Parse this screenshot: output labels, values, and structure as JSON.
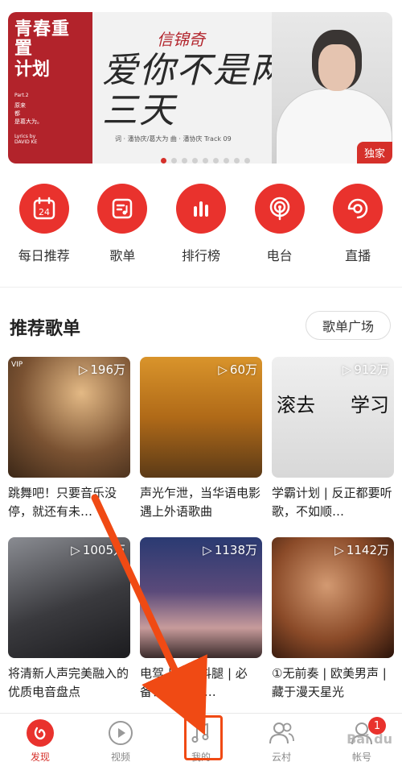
{
  "banner": {
    "left_title_line1": "青春重置",
    "left_title_line2": "计划",
    "part": "Part.2",
    "left_lines": [
      "原来",
      "都",
      "是葛大为。"
    ],
    "lyrics_by": "Lyrics by",
    "lyricist": "DAVID KE",
    "artist": "信锦奇",
    "song": "爱你不是两三天",
    "credits": "词 · 潘协庆/葛大为   曲 · 潘协庆      Track 09",
    "badge": "独家",
    "page_index": 1,
    "page_count": 9
  },
  "quick_links": [
    {
      "label": "每日推荐",
      "icon": "calendar-icon",
      "day": "24"
    },
    {
      "label": "歌单",
      "icon": "playlist-icon"
    },
    {
      "label": "排行榜",
      "icon": "chart-bars-icon"
    },
    {
      "label": "电台",
      "icon": "radio-icon"
    },
    {
      "label": "直播",
      "icon": "live-icon"
    }
  ],
  "section": {
    "title": "推荐歌单",
    "more_label": "歌单广场"
  },
  "playlists": [
    {
      "count": "196万",
      "vip": "VIP",
      "title": "跳舞吧！只要音乐没停，就还有未…",
      "colors": [
        "#6b4a2e",
        "#c99a63"
      ]
    },
    {
      "count": "60万",
      "title": "声光乍泄，当华语电影遇上外语歌曲",
      "colors": [
        "#b86e1f",
        "#e5b24a"
      ]
    },
    {
      "count": "912万",
      "title": "学霸计划 | 反正都要听歌，不如顺…",
      "cover_text_left": "滚去",
      "cover_text_right": "学习",
      "colors": [
        "#e6e6e6",
        "#cfcfcf"
      ]
    },
    {
      "count": "1005万",
      "title": "将清新人声完美融入的优质电音盘点",
      "colors": [
        "#2b2b2e",
        "#6b6d73"
      ]
    },
    {
      "count": "1138万",
      "title": "电驾 | 裁 | 抖腿 | 必备！ 欢迎巨…",
      "colors": [
        "#1d2a55",
        "#7a5a8a"
      ]
    },
    {
      "count": "1142万",
      "title": "①无前奏 | 欧美男声 | 藏于漫天星光",
      "colors": [
        "#3a1e10",
        "#b3714a"
      ]
    }
  ],
  "tabs": [
    {
      "label": "发现",
      "icon": "discover-icon",
      "active": true
    },
    {
      "label": "视频",
      "icon": "video-icon"
    },
    {
      "label": "我的",
      "icon": "music-note-icon"
    },
    {
      "label": "云村",
      "icon": "friends-icon"
    },
    {
      "label": "帐号",
      "icon": "account-icon",
      "badge": "1"
    }
  ],
  "watermark": "Bai du",
  "colors": {
    "accent": "#e9322d",
    "annotation": "#f04a14"
  }
}
